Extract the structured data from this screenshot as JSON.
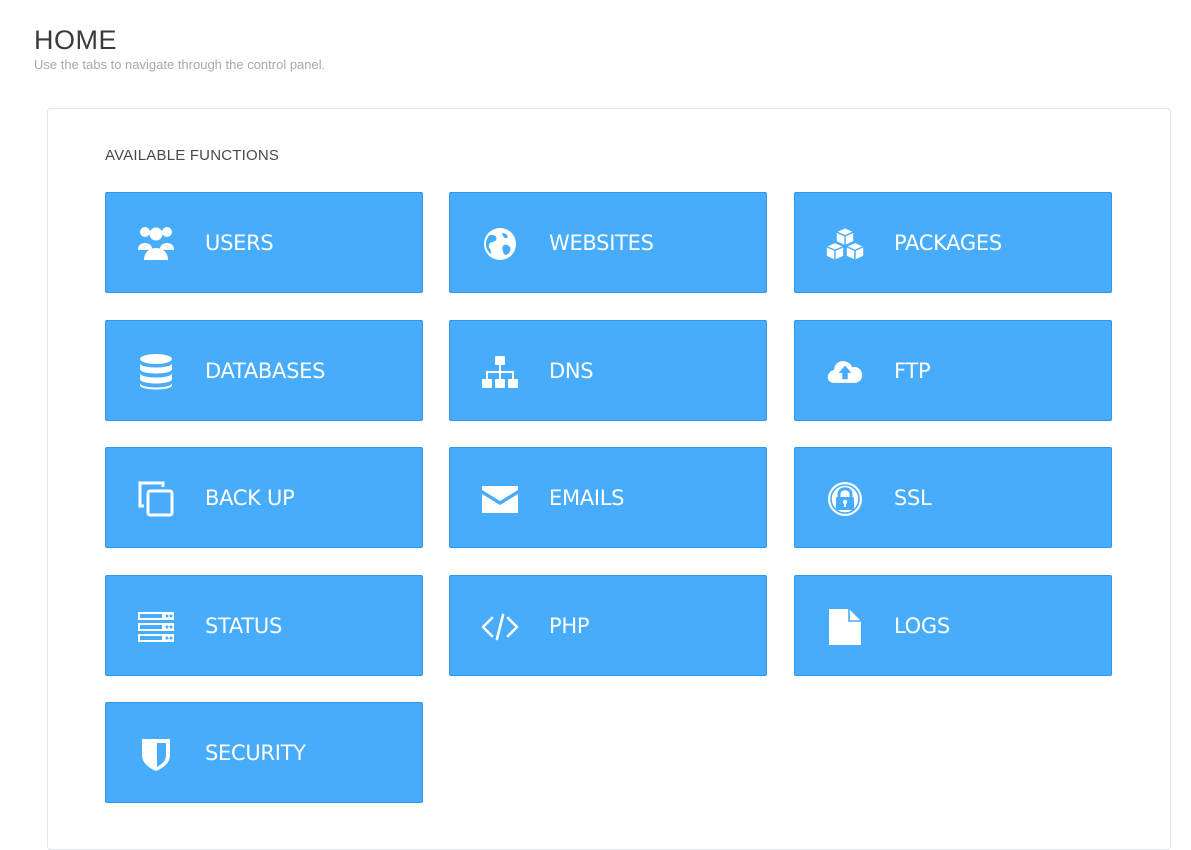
{
  "header": {
    "title": "HOME",
    "subtitle": "Use the tabs to navigate through the control panel."
  },
  "panel": {
    "section_title": "AVAILABLE FUNCTIONS",
    "accent_color": "#47acfb",
    "tiles": [
      {
        "label": "USERS",
        "icon": "users-icon"
      },
      {
        "label": "WEBSITES",
        "icon": "globe-icon"
      },
      {
        "label": "PACKAGES",
        "icon": "cubes-icon"
      },
      {
        "label": "DATABASES",
        "icon": "database-icon"
      },
      {
        "label": "DNS",
        "icon": "sitemap-icon"
      },
      {
        "label": "FTP",
        "icon": "cloud-upload-icon"
      },
      {
        "label": "BACK UP",
        "icon": "copy-icon"
      },
      {
        "label": "EMAILS",
        "icon": "envelope-icon"
      },
      {
        "label": "SSL",
        "icon": "lock-icon"
      },
      {
        "label": "STATUS",
        "icon": "server-icon"
      },
      {
        "label": "PHP",
        "icon": "code-icon"
      },
      {
        "label": "LOGS",
        "icon": "file-icon"
      },
      {
        "label": "SECURITY",
        "icon": "shield-icon"
      }
    ]
  }
}
